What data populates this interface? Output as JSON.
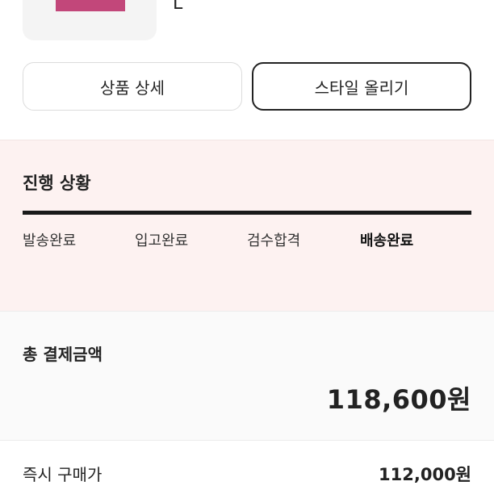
{
  "product": {
    "size": "L",
    "image_color": "#c2477a"
  },
  "actions": {
    "detail_label": "상품 상세",
    "style_label": "스타일 올리기"
  },
  "progress": {
    "title": "진행 상황",
    "steps": [
      "발송완료",
      "입고완료",
      "검수합격",
      "배송완료"
    ],
    "current_step": "배송완료",
    "completion": 1.0
  },
  "payment": {
    "total_label": "총 결제금액",
    "total_amount": "118,600원",
    "buy_now_label": "즉시 구매가",
    "buy_now_amount": "112,000원"
  },
  "colors": {
    "progress_bg": "#fdf2f1",
    "progress_fill": "#1a1a1a"
  }
}
